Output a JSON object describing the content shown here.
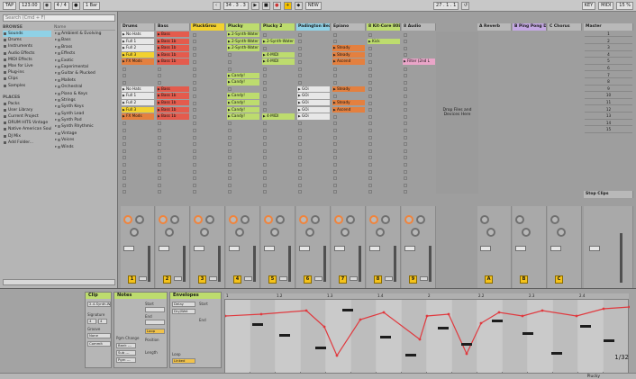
{
  "transport": {
    "tap": "TAP",
    "tempo": "123.00",
    "signature": "4 / 4",
    "quantize": "1 Bar",
    "position": "34 . 3 . 3",
    "new": "NEW",
    "loop_start": "27 . 1 . 1",
    "key": "KEY",
    "midi": "MIDI",
    "cpu": "15 %"
  },
  "browser": {
    "search_placeholder": "Search (Cmd + F)",
    "col_name": "Name",
    "browse_header": "BROWSE",
    "categories": [
      "Sounds",
      "Drums",
      "Instruments",
      "Audio Effects",
      "MIDI Effects",
      "Max for Live",
      "Plug-ins",
      "Clips",
      "Samples"
    ],
    "places_header": "PLACES",
    "places": [
      "Packs",
      "User Library",
      "Current Project",
      "DRUM HITS Vintage",
      "Native American Soul",
      "DJ Mix",
      "Add Folder..."
    ],
    "subfolders": [
      "Ambient & Evolving",
      "Bass",
      "Brass",
      "Effects",
      "Exotic",
      "Experimental",
      "Guitar & Plucked",
      "Mallets",
      "Orchestral",
      "Piano & Keys",
      "Strings",
      "Synth Keys",
      "Synth Lead",
      "Synth Pad",
      "Synth Rhythmic",
      "Vintage",
      "Voices",
      "Winds"
    ]
  },
  "tracks": [
    {
      "name": "Drums",
      "color": "#b9b9b9",
      "clips": [
        "No Hats",
        "Full 1",
        "Full 2",
        "Full 3",
        "FX Mods",
        "",
        "",
        "",
        "No Hats",
        "Full 1",
        "Full 2",
        "Full 3",
        "FX Mods"
      ],
      "clip_color": "#e7e7e7",
      "hl": [
        3,
        4,
        11,
        12
      ],
      "num": "1"
    },
    {
      "name": "Bass",
      "color": "#b9b9b9",
      "clips": [
        "Bass",
        "Bass 1b",
        "Bass 1b",
        "Bass 1b",
        "Bass 1b",
        "",
        "",
        "",
        "Bass",
        "Bass 1b",
        "Bass 1b",
        "Bass 1b",
        "Bass 1b"
      ],
      "clip_color": "#e45b4d",
      "hl": [],
      "num": "2"
    },
    {
      "name": "PluckGrou",
      "color": "#f2d12f",
      "clips": [],
      "clip_color": "#f2d12f",
      "hl": [],
      "num": "3"
    },
    {
      "name": "Plucky",
      "color": "#bddc6e",
      "clips": [
        "2-Synth-Water",
        "2-Synth-Water",
        "2-Synth-Water",
        "",
        "",
        "",
        "Candy!",
        "Candy!",
        "",
        "Candy!",
        "Candy!",
        "Candy!",
        "Candy!"
      ],
      "clip_color": "#bddc6e",
      "hl": [],
      "num": "4"
    },
    {
      "name": "Plucky 2",
      "color": "#bddc6e",
      "clips": [
        "",
        "2-Synth-Water",
        "",
        "4-MIDI",
        "4-MIDI",
        "",
        "",
        "",
        "",
        "",
        "",
        "",
        "4-MIDI"
      ],
      "clip_color": "#bddc6e",
      "hl": [],
      "num": "5"
    },
    {
      "name": "Padington Bear",
      "color": "#8fd1e6",
      "clips": [
        "",
        "",
        "",
        "",
        "",
        "",
        "",
        "",
        "GOi",
        "GOi",
        "GOi",
        "GOi",
        "GOi"
      ],
      "clip_color": "#e7e7e7",
      "hl": [],
      "num": "6"
    },
    {
      "name": "Epiano",
      "color": "#b9b9b9",
      "clips": [
        "",
        "",
        "Steady",
        "Steady",
        "Ascend",
        "",
        "",
        "",
        "Steady",
        "",
        "Steady",
        "Ascend",
        ""
      ],
      "clip_color": "#e4803f",
      "hl": [],
      "num": "7"
    },
    {
      "name": "8 Kit-Core 808",
      "color": "#bddc6e",
      "clips": [
        "",
        "Kick",
        "",
        "",
        "",
        "",
        "",
        "",
        "",
        "",
        "",
        "",
        ""
      ],
      "clip_color": "#bddc6e",
      "hl": [],
      "num": "8"
    },
    {
      "name": "8 Audio",
      "color": "#b9b9b9",
      "clips": [
        "",
        "",
        "",
        "",
        "Filter (2nd L",
        "",
        "",
        "",
        "",
        "",
        "",
        "",
        ""
      ],
      "clip_color": "#e9a5c8",
      "hl": [],
      "num": "9"
    }
  ],
  "drop_text": "Drop Files and Devices Here",
  "returns": [
    {
      "name": "A Reverb",
      "color": "#b9b9b9",
      "num": "A"
    },
    {
      "name": "B Ping Pong Delay",
      "color": "#c3a7e2",
      "num": "B"
    },
    {
      "name": "C Chorus",
      "color": "#b9b9b9",
      "num": "C"
    }
  ],
  "master": {
    "name": "Master",
    "scenes": [
      "1",
      "2",
      "3",
      "4",
      "5",
      "6",
      "7",
      "8",
      "9",
      "10",
      "11",
      "12",
      "13",
      "14",
      "15"
    ],
    "stop_label": "Stop Clips"
  },
  "detail": {
    "clip_header": "Clip",
    "clip_name": "2-4-Synth-Wat",
    "notes_header": "Notes",
    "envelopes_header": "Envelopes",
    "signature_label": "Signature",
    "sig_num": "4",
    "sig_den": "4",
    "groove_label": "Groove",
    "groove_value": "None",
    "commit": "Commit",
    "pgm_change": "Pgm Change",
    "bank": "Bank ---",
    "sub": "Sub ---",
    "pgm": "Pgm ---",
    "start": "Start",
    "end": "End",
    "loop": "Loop",
    "position": "Position",
    "length": "Length",
    "linked": "Linked",
    "env_device": "Delay",
    "env_param": "Dry/Wet",
    "page": "1/32",
    "ruler": [
      "1",
      "1.2",
      "1.3",
      "1.4",
      "2",
      "2.2",
      "2.3",
      "2.4"
    ],
    "footer_track": "Plucky"
  }
}
